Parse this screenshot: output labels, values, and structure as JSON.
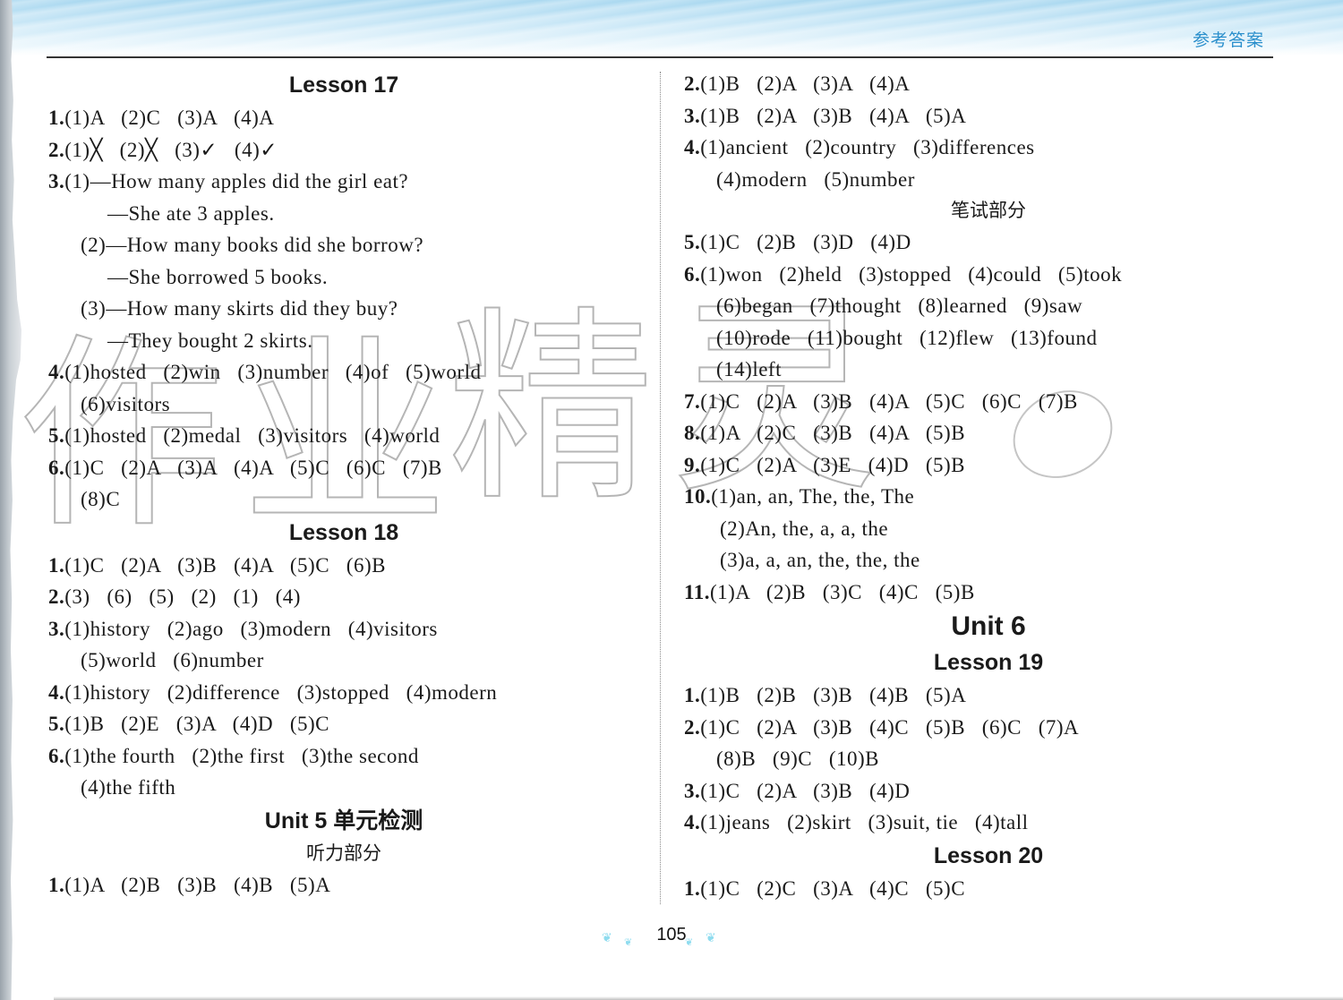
{
  "header": {
    "title": "参考答案"
  },
  "watermark": {
    "chars": [
      "作",
      "业",
      "精",
      "灵"
    ]
  },
  "left_column": [
    {
      "type": "heading",
      "text": "Lesson 17"
    },
    {
      "type": "line",
      "num": "1.",
      "text": "(1)A   (2)C   (3)A   (4)A"
    },
    {
      "type": "line",
      "num": "2.",
      "text": "(1)╳   (2)╳   (3)✓   (4)✓"
    },
    {
      "type": "line",
      "num": "3.",
      "text": "(1)—How many apples did the girl eat?"
    },
    {
      "type": "line",
      "indent": 2,
      "text": "—She ate 3 apples."
    },
    {
      "type": "line",
      "indent": 1,
      "text": "(2)—How many books did she borrow?"
    },
    {
      "type": "line",
      "indent": 2,
      "text": "—She borrowed 5 books."
    },
    {
      "type": "line",
      "indent": 1,
      "text": "(3)—How many skirts did they buy?"
    },
    {
      "type": "line",
      "indent": 2,
      "text": "—They bought 2 skirts."
    },
    {
      "type": "line",
      "num": "4.",
      "text": "(1)hosted   (2)win   (3)number   (4)of   (5)world"
    },
    {
      "type": "line",
      "indent": 1,
      "text": "(6)visitors"
    },
    {
      "type": "line",
      "num": "5.",
      "text": "(1)hosted   (2)medal   (3)visitors   (4)world"
    },
    {
      "type": "line",
      "num": "6.",
      "text": "(1)C   (2)A   (3)A   (4)A   (5)C   (6)C   (7)B"
    },
    {
      "type": "line",
      "indent": 1,
      "text": "(8)C"
    },
    {
      "type": "heading",
      "text": "Lesson 18"
    },
    {
      "type": "line",
      "num": "1.",
      "text": "(1)C   (2)A   (3)B   (4)A   (5)C   (6)B"
    },
    {
      "type": "line",
      "num": "2.",
      "text": "(3)   (6)   (5)   (2)   (1)   (4)"
    },
    {
      "type": "line",
      "num": "3.",
      "text": "(1)history   (2)ago   (3)modern   (4)visitors"
    },
    {
      "type": "line",
      "indent": 1,
      "text": "(5)world   (6)number"
    },
    {
      "type": "line",
      "num": "4.",
      "text": "(1)history   (2)difference   (3)stopped   (4)modern"
    },
    {
      "type": "line",
      "num": "5.",
      "text": "(1)B   (2)E   (3)A   (4)D   (5)C"
    },
    {
      "type": "line",
      "num": "6.",
      "text": "(1)the fourth   (2)the first   (3)the second"
    },
    {
      "type": "line",
      "indent": 1,
      "text": "(4)the fifth"
    },
    {
      "type": "heading",
      "text": "Unit 5 单元检测"
    },
    {
      "type": "subheading",
      "text": "听力部分"
    },
    {
      "type": "line",
      "num": "1.",
      "text": "(1)A   (2)B   (3)B   (4)B   (5)A"
    }
  ],
  "right_column": [
    {
      "type": "line",
      "num": "2.",
      "text": "(1)B   (2)A   (3)A   (4)A"
    },
    {
      "type": "line",
      "num": "3.",
      "text": "(1)B   (2)A   (3)B   (4)A   (5)A"
    },
    {
      "type": "line",
      "num": "4.",
      "text": "(1)ancient   (2)country   (3)differences"
    },
    {
      "type": "line",
      "indent": 1,
      "text": "(4)modern   (5)number"
    },
    {
      "type": "subheading",
      "text": "笔试部分"
    },
    {
      "type": "line",
      "num": "5.",
      "text": "(1)C   (2)B   (3)D   (4)D"
    },
    {
      "type": "line",
      "num": "6.",
      "text": "(1)won   (2)held   (3)stopped   (4)could   (5)took"
    },
    {
      "type": "line",
      "indent": 1,
      "text": "(6)began   (7)thought   (8)learned   (9)saw"
    },
    {
      "type": "line",
      "indent": 1,
      "text": "(10)rode   (11)bought   (12)flew   (13)found"
    },
    {
      "type": "line",
      "indent": 1,
      "text": "(14)left"
    },
    {
      "type": "line",
      "num": "7.",
      "text": "(1)C   (2)A   (3)B   (4)A   (5)C   (6)C   (7)B"
    },
    {
      "type": "line",
      "num": "8.",
      "text": "(1)A   (2)C   (3)B   (4)A   (5)B"
    },
    {
      "type": "line",
      "num": "9.",
      "text": "(1)C   (2)A   (3)E   (4)D   (5)B"
    },
    {
      "type": "line",
      "num": "10.",
      "text": "(1)an, an, The, the, The"
    },
    {
      "type": "line",
      "indent": 3,
      "text": "(2)An, the, a, a, the"
    },
    {
      "type": "line",
      "indent": 3,
      "text": "(3)a, a, an, the, the, the"
    },
    {
      "type": "line",
      "num": "11.",
      "text": "(1)A   (2)B   (3)C   (4)C   (5)B"
    },
    {
      "type": "heading",
      "big": true,
      "text": "Unit 6"
    },
    {
      "type": "heading",
      "text": "Lesson 19"
    },
    {
      "type": "line",
      "num": "1.",
      "text": "(1)B   (2)B   (3)B   (4)B   (5)A"
    },
    {
      "type": "line",
      "num": "2.",
      "text": "(1)C   (2)A   (3)B   (4)C   (5)B   (6)C   (7)A"
    },
    {
      "type": "line",
      "indent": 1,
      "text": "(8)B   (9)C   (10)B"
    },
    {
      "type": "line",
      "num": "3.",
      "text": "(1)C   (2)A   (3)B   (4)D"
    },
    {
      "type": "line",
      "num": "4.",
      "text": "(1)jeans   (2)skirt   (3)suit, tie   (4)tall"
    },
    {
      "type": "heading",
      "text": "Lesson 20"
    },
    {
      "type": "line",
      "num": "1.",
      "text": "(1)C   (2)C   (3)A   (4)C   (5)C"
    }
  ],
  "footer": {
    "page_number": "105"
  }
}
